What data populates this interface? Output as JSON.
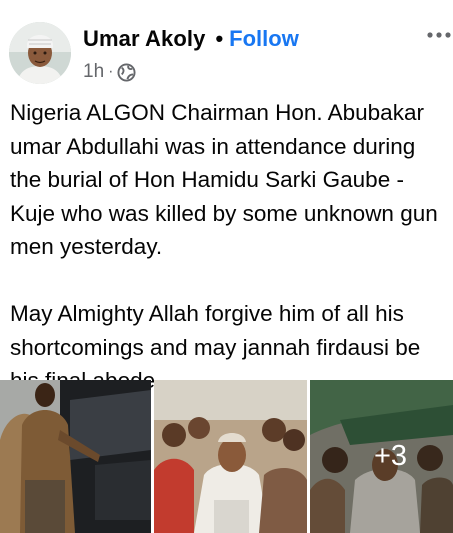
{
  "post": {
    "author": "Umar Akoly",
    "separator": "•",
    "follow_label": "Follow",
    "time": "1h",
    "time_separator": "·",
    "privacy_icon": "globe-icon",
    "more_icon": "more-options-icon",
    "paragraphs": [
      "Nigeria ALGON Chairman Hon. Abubakar umar Abdullahi was in attendance during the burial of Hon Hamidu Sarki Gaube - Kuje who was killed by some unknown gun men yesterday.",
      "May Almighty Allah forgive him of all his shortcomings and may jannah firdausi be his final abode."
    ],
    "photos": {
      "count": 3,
      "more_label": "+3"
    }
  },
  "colors": {
    "accent": "#1877f2",
    "text": "#050505",
    "secondary_text": "#65676b"
  }
}
